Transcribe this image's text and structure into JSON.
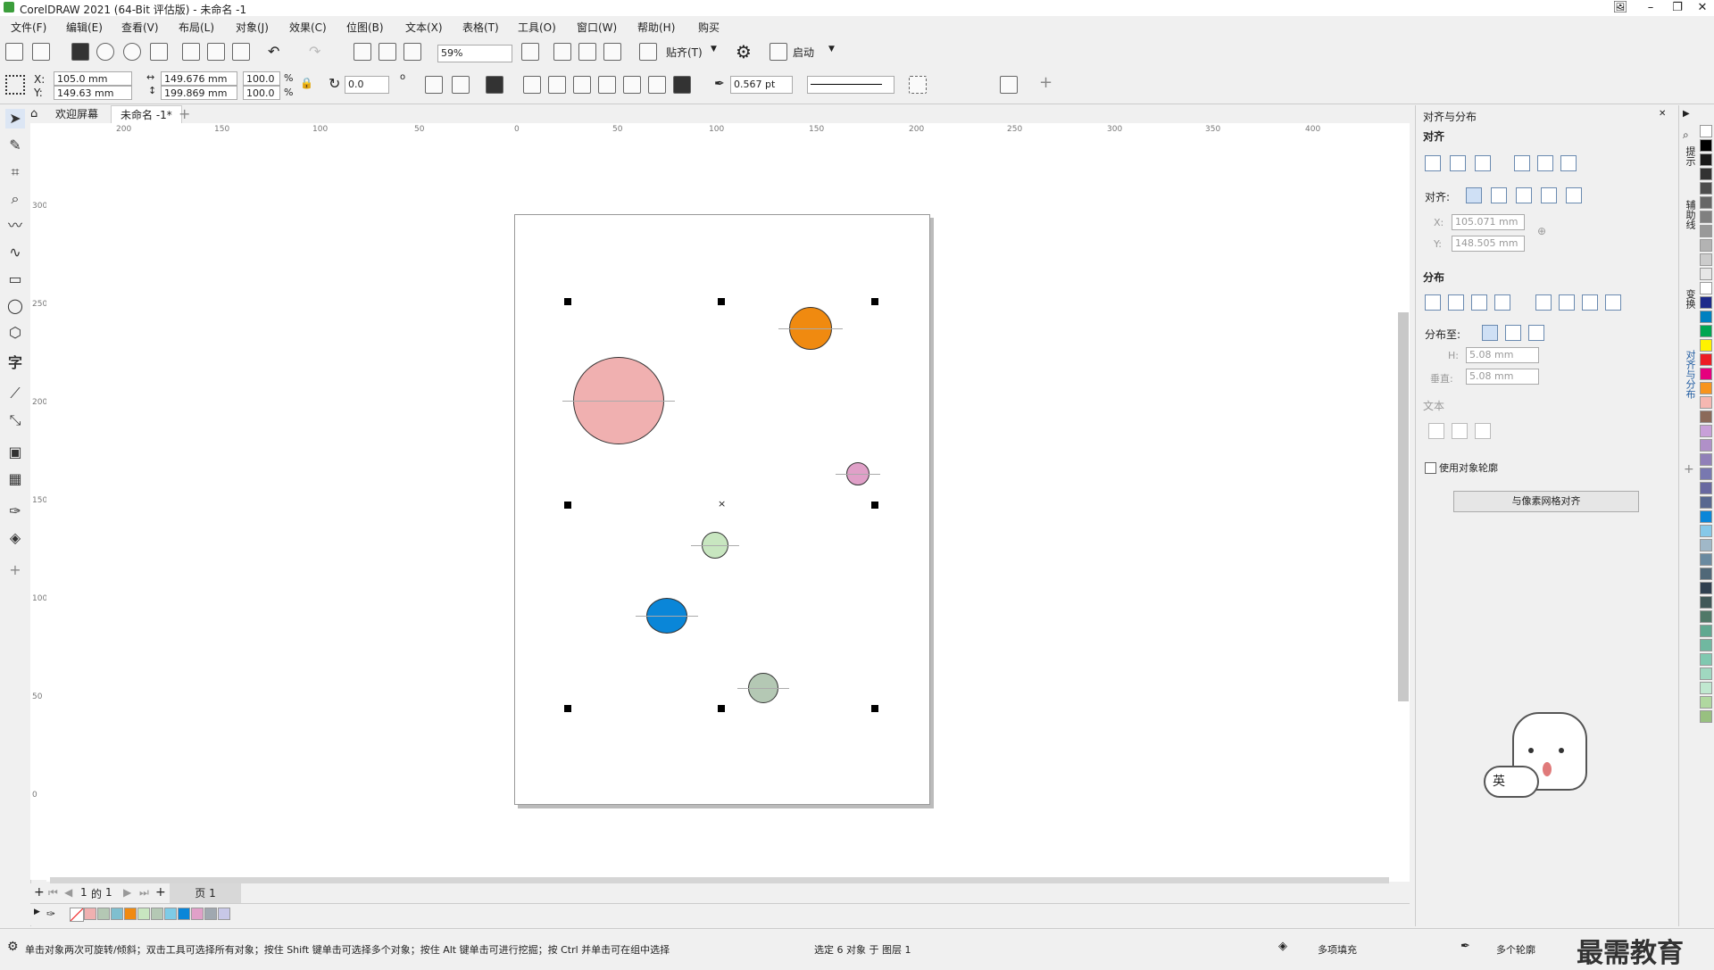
{
  "title_bar": {
    "title": "CorelDRAW 2021 (64-Bit 评估版) - 未命名 -1"
  },
  "menu": [
    "文件(F)",
    "编辑(E)",
    "查看(V)",
    "布局(L)",
    "对象(J)",
    "效果(C)",
    "位图(B)",
    "文本(X)",
    "表格(T)",
    "工具(O)",
    "窗口(W)",
    "帮助(H)",
    "购买"
  ],
  "toolbar": {
    "zoom": "59%",
    "snap_label": "贴齐(T)",
    "launch_label": "启动"
  },
  "propbar": {
    "x_label": "X:",
    "x_value": "105.0 mm",
    "y_label": "Y:",
    "y_value": "149.63 mm",
    "w_value": "149.676 mm",
    "h_value": "199.869 mm",
    "scale_w": "100.0",
    "scale_h": "100.0",
    "pct": "%",
    "rotation": "0.0",
    "outline_width": "0.567 pt"
  },
  "tabs": {
    "welcome": "欢迎屏幕",
    "doc": "未命名 -1*"
  },
  "ruler": {
    "h_ticks": [
      "200",
      "150",
      "100",
      "50",
      "0",
      "50",
      "100",
      "150",
      "200",
      "250",
      "300",
      "350",
      "400"
    ],
    "v_ticks": [
      "300",
      "250",
      "200",
      "150",
      "100",
      "50",
      "0"
    ]
  },
  "canvas": {
    "circles": [
      {
        "name": "orange-circle",
        "color": "#f08a10"
      },
      {
        "name": "pink-circle",
        "color": "#f0b0b0"
      },
      {
        "name": "small-pink-circle",
        "color": "#e0a0c8"
      },
      {
        "name": "light-green-circle",
        "color": "#c8e6c0"
      },
      {
        "name": "blue-circle",
        "color": "#0a86d8"
      },
      {
        "name": "gray-green-circle",
        "color": "#b4c8b4"
      }
    ]
  },
  "pages": {
    "current": "1",
    "of": "的",
    "total": "1",
    "page_tab": "页 1"
  },
  "panel": {
    "header": "对齐与分布",
    "align_section": "对齐",
    "align_to_label": "对齐:",
    "x_label": "X:",
    "x_value": "105.071 mm",
    "y_label": "Y:",
    "y_value": "148.505 mm",
    "distribute_section": "分布",
    "distribute_to_label": "分布至:",
    "h_label": "H:",
    "h_value": "5.08 mm",
    "v_label": "垂直:",
    "v_value": "5.08 mm",
    "text_section": "文本",
    "use_outline": "使用对象轮廓",
    "pixel_grid_button": "与像素网格对齐"
  },
  "dock_tabs": [
    "提示",
    "辅助线",
    "变换",
    "对齐与分布"
  ],
  "palette_colors": [
    "#ffffff",
    "#000000",
    "#1a1a1a",
    "#333333",
    "#4d4d4d",
    "#666666",
    "#808080",
    "#999999",
    "#b3b3b3",
    "#cccccc",
    "#e6e6e6",
    "#ffffff",
    "#1d2a8a",
    "#0080c0",
    "#00a651",
    "#fff200",
    "#ed1c24",
    "#e6007e",
    "#f7941d",
    "#f5b7b1",
    "#8b6a5a",
    "#c8a0d8",
    "#b090c8",
    "#9080b8",
    "#7878b0",
    "#6868a0",
    "#586890",
    "#0a86d8",
    "#86c8e8",
    "#a0b8c8",
    "#6a8aa0",
    "#506878",
    "#304050",
    "#405858",
    "#507868",
    "#60a890",
    "#70b8a0",
    "#80c8b0",
    "#a0d8c0",
    "#c0e8d0",
    "#b0d8a0",
    "#98c080"
  ],
  "doc_palette": [
    "#f0b0b0",
    "#b4c8b4",
    "#7fbfcf",
    "#f08a10",
    "#c8e6c0",
    "#b4c8b4",
    "#7ecbe6",
    "#0a86d8",
    "#e0a0c8",
    "#a0a8b0",
    "#c8c8e8"
  ],
  "status": {
    "hint": "单击对象两次可旋转/倾斜；双击工具可选择所有对象；按住 Shift 键单击可选择多个对象；按住 Alt 键单击可进行挖掘；按 Ctrl 并单击可在组中选择",
    "selection": "选定 6 对象 于 图层 1",
    "fill": "多项填充",
    "outline": "多个轮廓"
  },
  "watermark": "最需教育",
  "sticker_text": "英"
}
